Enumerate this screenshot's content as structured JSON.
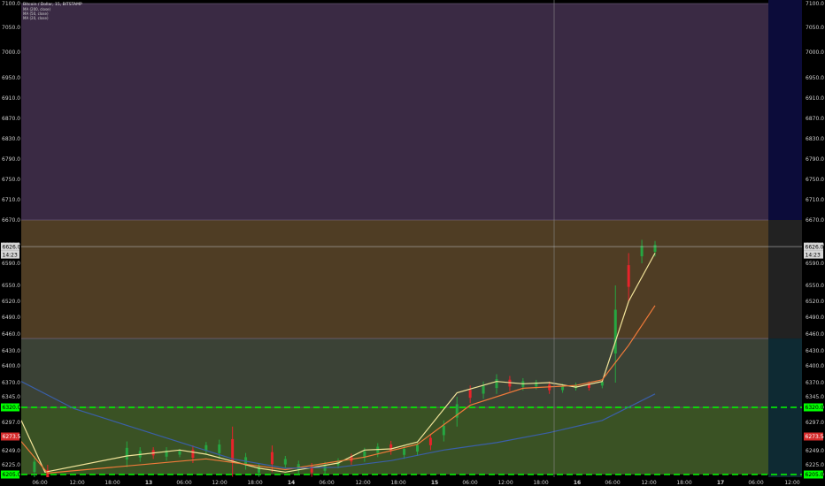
{
  "legend": {
    "title": "Bitcoin / Dollar, 15, BITSTAMP",
    "lines": [
      "MA (200, close)",
      "MA (50, close)",
      "MA (20, close)"
    ]
  },
  "price_tags": {
    "last": "6626.0",
    "countdown": "14:23",
    "level_upper": "6320.0",
    "red_marker": "6273.5",
    "level_lower": "6205.0"
  },
  "colors": {
    "zone_top": "#3a2a44",
    "zone_mid": "#4f3d24",
    "zone_low": "#3b4236",
    "zone_green": "#3a5224",
    "right_strip": "#0c0c3a",
    "right_strip_lower": "#222222",
    "candle_up": "#26a641",
    "candle_down": "#e8232a",
    "ma_short": "#f2e49a",
    "ma_mid": "#f07a3a",
    "ma_long": "#3a5fa8",
    "level_line": "#00ff00",
    "red_tag": "#d42a2a"
  },
  "chart_data": {
    "type": "line",
    "title": "Bitcoin / Dollar, 15, BITSTAMP",
    "ylim": [
      6205,
      7100
    ],
    "y_ticks": [
      "7100.0",
      "7050.0",
      "7000.0",
      "6950.0",
      "6910.0",
      "6870.0",
      "6830.0",
      "6790.0",
      "6750.0",
      "6710.0",
      "6670.0",
      "6630.0",
      "6590.0",
      "6550.0",
      "6520.0",
      "6490.0",
      "6460.0",
      "6430.0",
      "6400.0",
      "6370.0",
      "6345.0",
      "6320.0",
      "6297.0",
      "6273.5",
      "6249.0",
      "6225.0",
      "6205.0"
    ],
    "x_ticks": [
      "06:00",
      "12:00",
      "18:00",
      "13",
      "06:00",
      "12:00",
      "18:00",
      "14",
      "06:00",
      "12:00",
      "18:00",
      "15",
      "06:00",
      "12:00",
      "18:00",
      "16",
      "06:00",
      "12:00",
      "18:00",
      "17",
      "06:00",
      "12:00"
    ],
    "zones": [
      {
        "from": 6670,
        "to": 7100,
        "color": "#3a2a44"
      },
      {
        "from": 6452,
        "to": 6670,
        "color": "#4f3d24"
      },
      {
        "from": 6320,
        "to": 6452,
        "color": "#3b4236"
      },
      {
        "from": 6205,
        "to": 6320,
        "color": "#3a5224"
      }
    ],
    "levels": [
      6320,
      6205
    ],
    "crosshair_price": 6626,
    "series": [
      {
        "name": "MA (20, close)",
        "color": "#f2e49a",
        "points": [
          [
            0,
            6300
          ],
          [
            1.8,
            6210
          ],
          [
            8,
            6240
          ],
          [
            12,
            6250
          ],
          [
            14,
            6243
          ],
          [
            18,
            6218
          ],
          [
            20,
            6210
          ],
          [
            24,
            6228
          ],
          [
            26,
            6250
          ],
          [
            28,
            6252
          ],
          [
            30,
            6264
          ],
          [
            33,
            6352
          ],
          [
            36,
            6372
          ],
          [
            38,
            6368
          ],
          [
            40,
            6370
          ],
          [
            42,
            6362
          ],
          [
            44,
            6372
          ],
          [
            46,
            6520
          ],
          [
            48,
            6612
          ]
        ]
      },
      {
        "name": "MA (50, close)",
        "color": "#f07a3a",
        "points": [
          [
            0,
            6265
          ],
          [
            2,
            6208
          ],
          [
            14,
            6235
          ],
          [
            20,
            6215
          ],
          [
            26,
            6238
          ],
          [
            30,
            6260
          ],
          [
            34,
            6325
          ],
          [
            38,
            6360
          ],
          [
            42,
            6365
          ],
          [
            44,
            6375
          ],
          [
            46,
            6440
          ],
          [
            48,
            6512
          ]
        ]
      },
      {
        "name": "MA (200, close)",
        "color": "#3a5fa8",
        "points": [
          [
            0,
            6372
          ],
          [
            4,
            6318
          ],
          [
            10,
            6278
          ],
          [
            16,
            6235
          ],
          [
            20,
            6218
          ],
          [
            24,
            6220
          ],
          [
            28,
            6232
          ],
          [
            32,
            6250
          ],
          [
            36,
            6263
          ],
          [
            40,
            6280
          ],
          [
            44,
            6300
          ],
          [
            48,
            6350
          ]
        ]
      }
    ],
    "candles": [
      [
        1,
        6240,
        6195
      ],
      [
        2,
        6225,
        6180
      ],
      [
        8,
        6265,
        6220
      ],
      [
        9,
        6255,
        6230
      ],
      [
        10,
        6255,
        6235
      ],
      [
        11,
        6255,
        6232
      ],
      [
        12,
        6252,
        6238
      ],
      [
        13,
        6258,
        6228
      ],
      [
        14,
        6264,
        6242
      ],
      [
        15,
        6268,
        6235
      ],
      [
        16,
        6290,
        6200
      ],
      [
        17,
        6245,
        6215
      ],
      [
        18,
        6228,
        6200
      ],
      [
        19,
        6258,
        6210
      ],
      [
        20,
        6240,
        6218
      ],
      [
        21,
        6232,
        6205
      ],
      [
        22,
        6228,
        6200
      ],
      [
        23,
        6230,
        6205
      ],
      [
        24,
        6236,
        6218
      ],
      [
        25,
        6244,
        6225
      ],
      [
        26,
        6254,
        6230
      ],
      [
        27,
        6262,
        6238
      ],
      [
        28,
        6266,
        6242
      ],
      [
        29,
        6258,
        6235
      ],
      [
        30,
        6265,
        6240
      ],
      [
        31,
        6278,
        6250
      ],
      [
        32,
        6300,
        6265
      ],
      [
        33,
        6345,
        6290
      ],
      [
        34,
        6365,
        6330
      ],
      [
        35,
        6372,
        6340
      ],
      [
        36,
        6385,
        6350
      ],
      [
        37,
        6382,
        6355
      ],
      [
        38,
        6378,
        6356
      ],
      [
        39,
        6375,
        6358
      ],
      [
        40,
        6372,
        6350
      ],
      [
        41,
        6368,
        6352
      ],
      [
        42,
        6370,
        6356
      ],
      [
        43,
        6372,
        6356
      ],
      [
        44,
        6376,
        6360
      ],
      [
        45,
        6550,
        6370
      ],
      [
        46,
        6612,
        6520
      ],
      [
        47,
        6638,
        6590
      ],
      [
        48,
        6636,
        6605
      ]
    ]
  },
  "x_axis_day_marks": [
    "13",
    "14",
    "15",
    "16",
    "17"
  ]
}
